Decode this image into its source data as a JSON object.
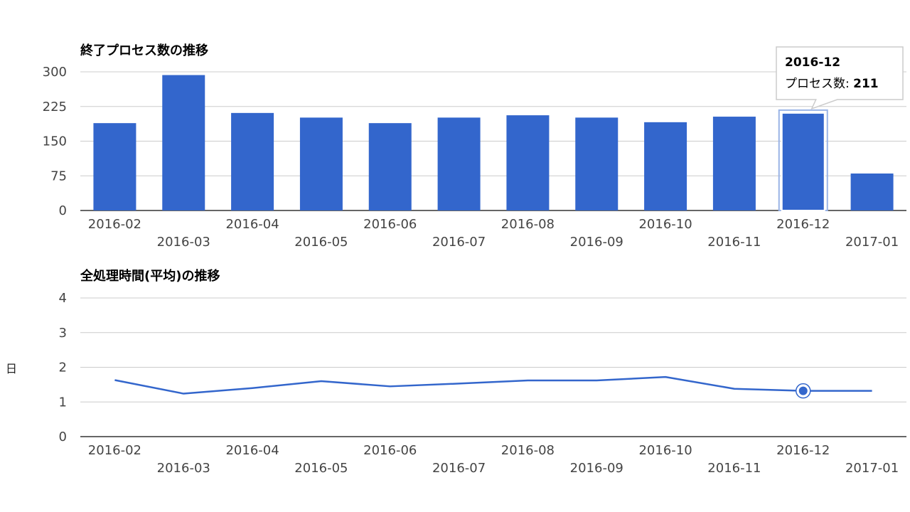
{
  "chart_data": [
    {
      "type": "bar",
      "title": "終了プロセス数の推移",
      "categories": [
        "2016-02",
        "2016-03",
        "2016-04",
        "2016-05",
        "2016-06",
        "2016-07",
        "2016-08",
        "2016-09",
        "2016-10",
        "2016-11",
        "2016-12",
        "2017-01"
      ],
      "values": [
        189,
        293,
        211,
        201,
        189,
        201,
        206,
        201,
        191,
        203,
        211,
        80
      ],
      "ylim": [
        0,
        300
      ],
      "yticks": [
        0,
        75,
        150,
        225,
        300
      ],
      "color": "#3366cc",
      "grid": true,
      "tooltip": {
        "category": "2016-12",
        "label": "プロセス数",
        "value": "211"
      }
    },
    {
      "type": "line",
      "title": "全処理時間(平均)の推移",
      "ylabel": "日",
      "categories": [
        "2016-02",
        "2016-03",
        "2016-04",
        "2016-05",
        "2016-06",
        "2016-07",
        "2016-08",
        "2016-09",
        "2016-10",
        "2016-11",
        "2016-12",
        "2017-01"
      ],
      "values": [
        1.63,
        1.24,
        1.4,
        1.6,
        1.45,
        1.53,
        1.62,
        1.62,
        1.72,
        1.38,
        1.32,
        1.32
      ],
      "ylim": [
        0,
        4
      ],
      "yticks": [
        0,
        1,
        2,
        3,
        4
      ],
      "color": "#3366cc",
      "grid": true,
      "highlight": "2016-12"
    }
  ]
}
